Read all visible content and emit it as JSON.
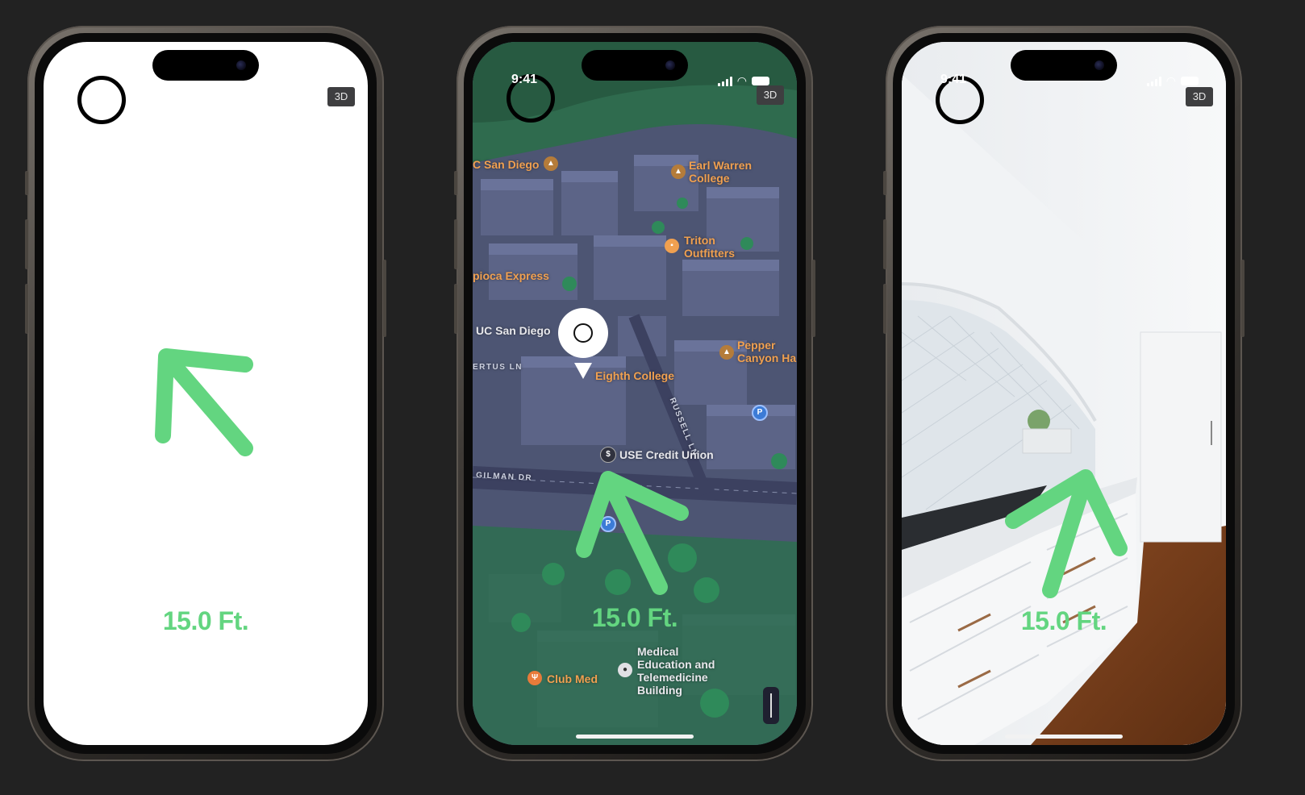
{
  "status_bar": {
    "time": "9:41"
  },
  "controls": {
    "view_toggle_label": "3D"
  },
  "distance": {
    "readout": "15.0 Ft."
  },
  "map": {
    "labels": {
      "uc_san_diego_top": "C San Diego",
      "earl_warren": "Earl Warren College",
      "earl_warren_line1": "Earl Warren",
      "earl_warren_line2": "College",
      "triton_line1": "Triton",
      "triton_line2": "Outfitters",
      "tapioca": "pioca Express",
      "uc_san_diego_mid": "UC San Diego",
      "pepper_line1": "Pepper",
      "pepper_line2": "Canyon Ha",
      "eighth_college": "Eighth College",
      "usd_credit_union": "USE Credit Union",
      "club_med": "Club Med",
      "medical_line1": "Medical",
      "medical_line2": "Education and",
      "medical_line3": "Telemedicine",
      "medical_line4": "Building"
    },
    "streets": {
      "gilman": "GILMAN DR",
      "russell": "RUSSELL LN",
      "ertus": "ERTUS LN"
    },
    "parking_label": "P"
  },
  "colors": {
    "accent_green": "#63d580",
    "map_label_orange": "#f0a050",
    "background": "#222222"
  },
  "icons": {
    "arrow": "direction-arrow-icon",
    "ring": "target-ring-icon"
  }
}
